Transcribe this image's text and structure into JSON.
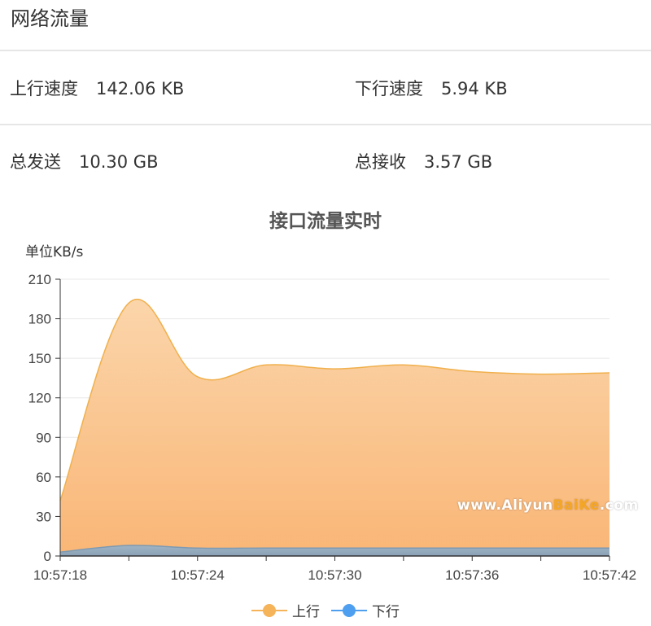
{
  "panel": {
    "title": "网络流量"
  },
  "stats": {
    "up_speed": {
      "label": "上行速度",
      "value": "142.06 KB"
    },
    "down_speed": {
      "label": "下行速度",
      "value": "5.94 KB"
    },
    "total_sent": {
      "label": "总发送",
      "value": "10.30 GB"
    },
    "total_recv": {
      "label": "总接收",
      "value": "3.57 GB"
    }
  },
  "watermark": {
    "prefix": "www.Aliyun",
    "accent": "BaiKe",
    "suffix": ".com"
  },
  "colors": {
    "up": "#f5b35a",
    "down": "#4e9ff0",
    "grid": "#e8e8e8",
    "axis": "#333333"
  },
  "chart_data": {
    "type": "area",
    "title": "接口流量实时",
    "ylabel": "单位KB/s",
    "ylim": [
      0,
      210
    ],
    "yticks": [
      0,
      30,
      60,
      90,
      120,
      150,
      180,
      210
    ],
    "x": [
      "10:57:18",
      "10:57:21",
      "10:57:24",
      "10:57:27",
      "10:57:30",
      "10:57:33",
      "10:57:36",
      "10:57:39",
      "10:57:42"
    ],
    "xtick_labels": [
      "10:57:18",
      "10:57:24",
      "10:57:30",
      "10:57:36",
      "10:57:42"
    ],
    "grid": true,
    "legend_position": "bottom",
    "series": [
      {
        "name": "上行",
        "values": [
          42,
          192,
          136,
          145,
          142,
          145,
          140,
          138,
          139
        ]
      },
      {
        "name": "下行",
        "values": [
          3,
          8,
          6,
          6,
          6,
          6,
          6,
          6,
          6
        ]
      }
    ]
  }
}
